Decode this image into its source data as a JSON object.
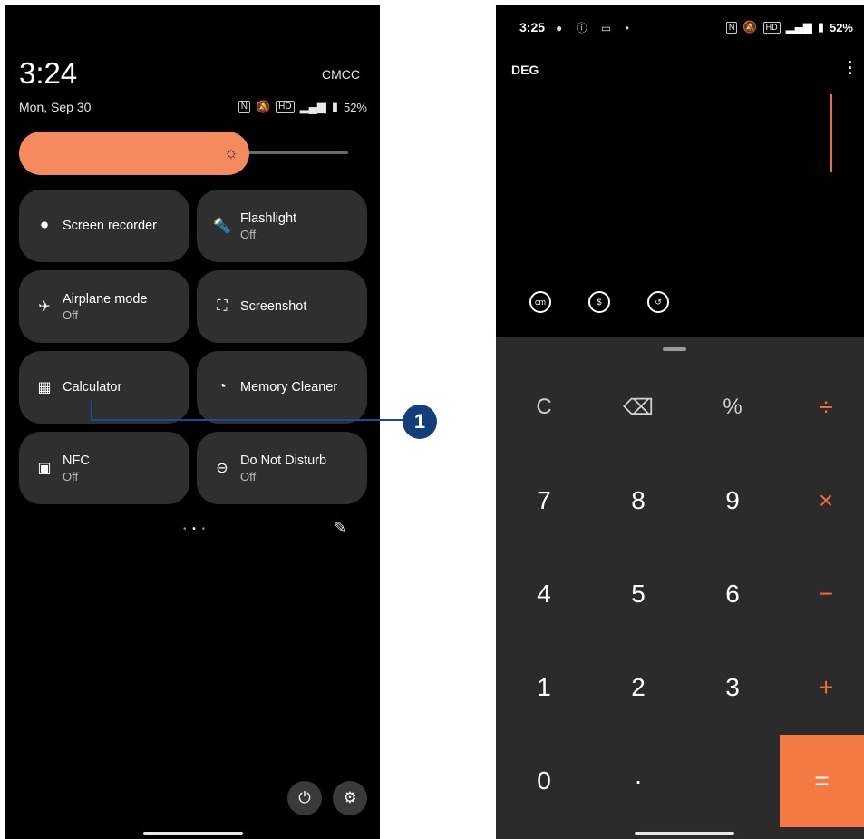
{
  "left": {
    "time": "3:24",
    "carrier": "CMCC",
    "date": "Mon, Sep 30",
    "battery": "52%",
    "brightness_level": 0.62,
    "tiles": [
      {
        "label": "Screen recorder",
        "sub": "",
        "icon": "screen-recorder-icon",
        "glyph": "⏺"
      },
      {
        "label": "Flashlight",
        "sub": "Off",
        "icon": "flashlight-icon",
        "glyph": "🔦"
      },
      {
        "label": "Airplane mode",
        "sub": "Off",
        "icon": "airplane-icon",
        "glyph": "✈"
      },
      {
        "label": "Screenshot",
        "sub": "",
        "icon": "screenshot-icon",
        "glyph": "⛶"
      },
      {
        "label": "Calculator",
        "sub": "",
        "icon": "calculator-icon",
        "glyph": "▦"
      },
      {
        "label": "Memory Cleaner",
        "sub": "",
        "icon": "memory-cleaner-icon",
        "glyph": "◔"
      },
      {
        "label": "NFC",
        "sub": "Off",
        "icon": "nfc-icon",
        "glyph": "▣"
      },
      {
        "label": "Do Not Disturb",
        "sub": "Off",
        "icon": "do-not-disturb-icon",
        "glyph": "⊖"
      }
    ]
  },
  "callout": {
    "number": "1"
  },
  "right": {
    "time": "3:25",
    "battery": "52%",
    "mode": "DEG",
    "keys": [
      [
        "C",
        "⌫",
        "%",
        "÷"
      ],
      [
        "7",
        "8",
        "9",
        "×"
      ],
      [
        "4",
        "5",
        "6",
        "−"
      ],
      [
        "1",
        "2",
        "3",
        "+"
      ],
      [
        "0",
        "·",
        "",
        "="
      ]
    ]
  },
  "colors": {
    "accent": "#f26b3a",
    "tile": "#2f2f2f",
    "brightness": "#f58a5f",
    "callout": "#123f7a"
  }
}
